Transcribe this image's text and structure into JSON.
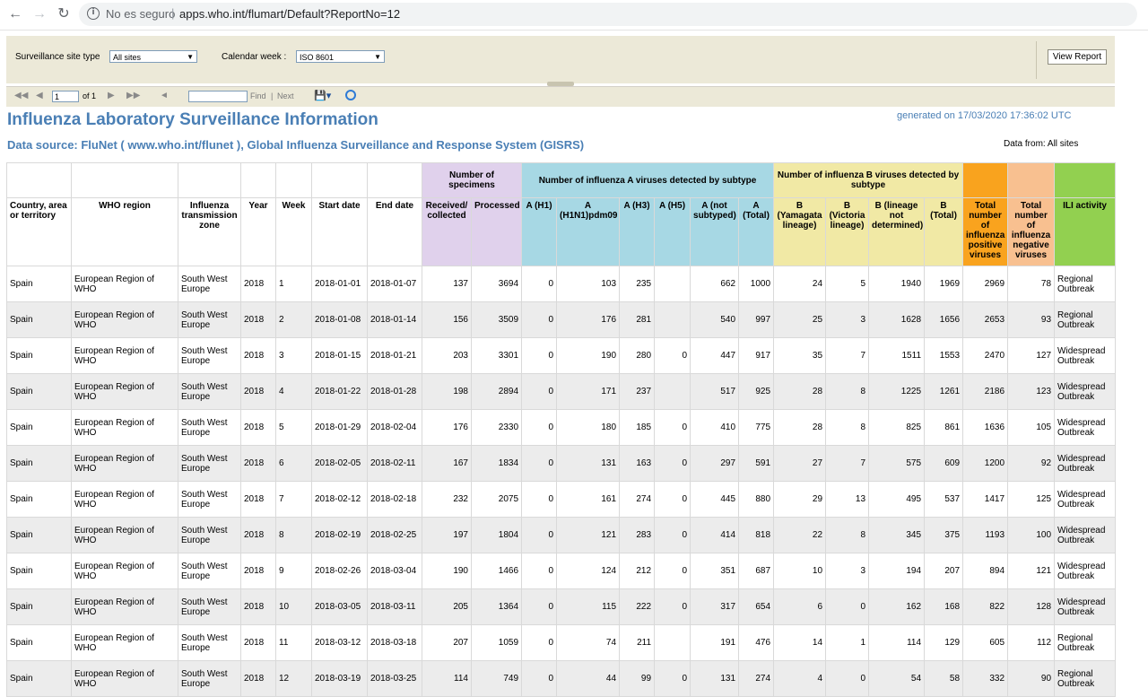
{
  "browser": {
    "security_label": "No es seguro",
    "separator": "|",
    "url": "apps.who.int/flumart/Default?ReportNo=12"
  },
  "params": {
    "site_type_label": "Surveillance site type",
    "site_type_value": "All sites",
    "week_label": "Calendar week :",
    "week_value": "ISO 8601",
    "view_report": "View Report"
  },
  "toolbar": {
    "page_value": "1",
    "page_of": "of 1",
    "find": "Find",
    "sep": "|",
    "next": "Next"
  },
  "report": {
    "title": "Influenza Laboratory Surveillance Information",
    "generated": "generated on 17/03/2020 17:36:02 UTC",
    "source": "Data source: FluNet ( www.who.int/flunet ), Global Influenza Surveillance and Response System (GISRS)",
    "data_from": "Data from: All sites"
  },
  "colors": {
    "specimens": "#e0d1ec",
    "influenza_a": "#a7d8e4",
    "influenza_b": "#f1e9a5",
    "total_positive": "#f9a31e",
    "total_negative": "#f8c090",
    "ili": "#92d050",
    "title": "#4a7fb5"
  },
  "table": {
    "groups": {
      "specimens": "Number of specimens",
      "influenza_a": "Number of influenza A viruses detected by subtype",
      "influenza_b": "Number of influenza B viruses detected by subtype"
    },
    "headers": [
      "Country, area or territory",
      "WHO region",
      "Influenza transmission zone",
      "Year",
      "Week",
      "Start date",
      "End date",
      "Received/ collected",
      "Processed",
      "A (H1)",
      "A (H1N1)pdm09",
      "A (H3)",
      "A (H5)",
      "A (not subtyped)",
      "A (Total)",
      "B (Yamagata lineage)",
      "B (Victoria lineage)",
      "B (lineage not determined)",
      "B (Total)",
      "Total number of influenza positive viruses",
      "Total number of influenza negative viruses",
      "ILI activity"
    ],
    "rows": [
      [
        "Spain",
        "European Region of WHO",
        "South West Europe",
        "2018",
        "1",
        "2018-01-01",
        "2018-01-07",
        "137",
        "3694",
        "0",
        "103",
        "235",
        "",
        "662",
        "1000",
        "24",
        "5",
        "1940",
        "1969",
        "2969",
        "78",
        "Regional Outbreak"
      ],
      [
        "Spain",
        "European Region of WHO",
        "South West Europe",
        "2018",
        "2",
        "2018-01-08",
        "2018-01-14",
        "156",
        "3509",
        "0",
        "176",
        "281",
        "",
        "540",
        "997",
        "25",
        "3",
        "1628",
        "1656",
        "2653",
        "93",
        "Regional Outbreak"
      ],
      [
        "Spain",
        "European Region of WHO",
        "South West Europe",
        "2018",
        "3",
        "2018-01-15",
        "2018-01-21",
        "203",
        "3301",
        "0",
        "190",
        "280",
        "0",
        "447",
        "917",
        "35",
        "7",
        "1511",
        "1553",
        "2470",
        "127",
        "Widespread Outbreak"
      ],
      [
        "Spain",
        "European Region of WHO",
        "South West Europe",
        "2018",
        "4",
        "2018-01-22",
        "2018-01-28",
        "198",
        "2894",
        "0",
        "171",
        "237",
        "",
        "517",
        "925",
        "28",
        "8",
        "1225",
        "1261",
        "2186",
        "123",
        "Widespread Outbreak"
      ],
      [
        "Spain",
        "European Region of WHO",
        "South West Europe",
        "2018",
        "5",
        "2018-01-29",
        "2018-02-04",
        "176",
        "2330",
        "0",
        "180",
        "185",
        "0",
        "410",
        "775",
        "28",
        "8",
        "825",
        "861",
        "1636",
        "105",
        "Widespread Outbreak"
      ],
      [
        "Spain",
        "European Region of WHO",
        "South West Europe",
        "2018",
        "6",
        "2018-02-05",
        "2018-02-11",
        "167",
        "1834",
        "0",
        "131",
        "163",
        "0",
        "297",
        "591",
        "27",
        "7",
        "575",
        "609",
        "1200",
        "92",
        "Widespread Outbreak"
      ],
      [
        "Spain",
        "European Region of WHO",
        "South West Europe",
        "2018",
        "7",
        "2018-02-12",
        "2018-02-18",
        "232",
        "2075",
        "0",
        "161",
        "274",
        "0",
        "445",
        "880",
        "29",
        "13",
        "495",
        "537",
        "1417",
        "125",
        "Widespread Outbreak"
      ],
      [
        "Spain",
        "European Region of WHO",
        "South West Europe",
        "2018",
        "8",
        "2018-02-19",
        "2018-02-25",
        "197",
        "1804",
        "0",
        "121",
        "283",
        "0",
        "414",
        "818",
        "22",
        "8",
        "345",
        "375",
        "1193",
        "100",
        "Widespread Outbreak"
      ],
      [
        "Spain",
        "European Region of WHO",
        "South West Europe",
        "2018",
        "9",
        "2018-02-26",
        "2018-03-04",
        "190",
        "1466",
        "0",
        "124",
        "212",
        "0",
        "351",
        "687",
        "10",
        "3",
        "194",
        "207",
        "894",
        "121",
        "Widespread Outbreak"
      ],
      [
        "Spain",
        "European Region of WHO",
        "South West Europe",
        "2018",
        "10",
        "2018-03-05",
        "2018-03-11",
        "205",
        "1364",
        "0",
        "115",
        "222",
        "0",
        "317",
        "654",
        "6",
        "0",
        "162",
        "168",
        "822",
        "128",
        "Widespread Outbreak"
      ],
      [
        "Spain",
        "European Region of WHO",
        "South West Europe",
        "2018",
        "11",
        "2018-03-12",
        "2018-03-18",
        "207",
        "1059",
        "0",
        "74",
        "211",
        "",
        "191",
        "476",
        "14",
        "1",
        "114",
        "129",
        "605",
        "112",
        "Regional Outbreak"
      ],
      [
        "Spain",
        "European Region of WHO",
        "South West Europe",
        "2018",
        "12",
        "2018-03-19",
        "2018-03-25",
        "114",
        "749",
        "0",
        "44",
        "99",
        "0",
        "131",
        "274",
        "4",
        "0",
        "54",
        "58",
        "332",
        "90",
        "Regional Outbreak"
      ]
    ]
  }
}
